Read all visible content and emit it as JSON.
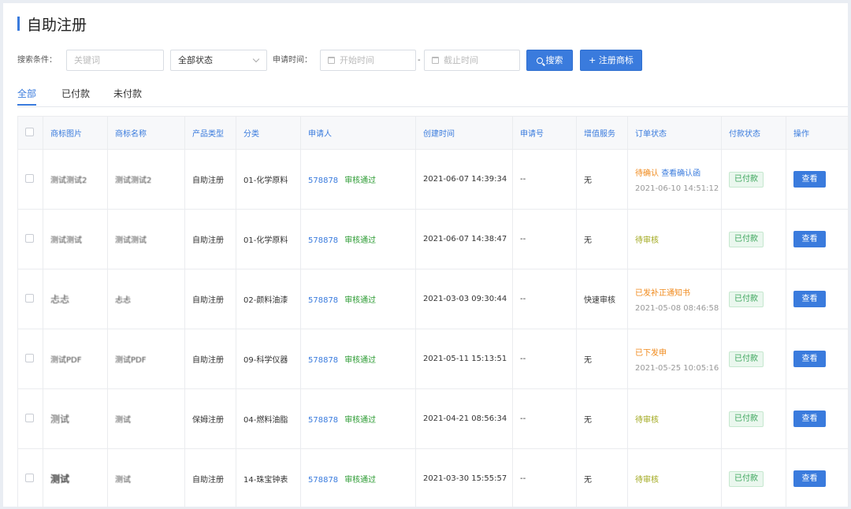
{
  "page": {
    "title": "自助注册"
  },
  "filter": {
    "search_label": "搜索条件：",
    "keyword_placeholder": "关键词",
    "status_value": "全部状态",
    "time_label": "申请时间：",
    "start_placeholder": "开始时间",
    "range_sep": "-",
    "end_placeholder": "截止时间",
    "search_button": "搜索",
    "register_button": "+ 注册商标"
  },
  "tabs": [
    "全部",
    "已付款",
    "未付款"
  ],
  "table": {
    "headers": [
      "商标图片",
      "商标名称",
      "产品类型",
      "分类",
      "申请人",
      "创建时间",
      "申请号",
      "增值服务",
      "订单状态",
      "付款状态",
      "操作"
    ],
    "rows": [
      {
        "image_text": "测试测试2",
        "name": "测试测试2",
        "product": "自助注册",
        "category": "01-化学原料",
        "applicant": "578878",
        "review": "审核通过",
        "created": "2021-06-07 14:39:34",
        "app_no": "--",
        "service": "无",
        "status": "待确认",
        "status_link": "查看确认函",
        "status_time": "2021-06-10 14:51:12",
        "pay": "已付款",
        "action": "查看"
      },
      {
        "image_text": "测试测试",
        "name": "测试测试",
        "product": "自助注册",
        "category": "01-化学原料",
        "applicant": "578878",
        "review": "审核通过",
        "created": "2021-06-07 14:38:47",
        "app_no": "--",
        "service": "无",
        "status": "待审核",
        "status_link": "",
        "status_time": "",
        "pay": "已付款",
        "action": "查看"
      },
      {
        "image_text": "忐忐",
        "name": "忐忐",
        "product": "自助注册",
        "category": "02-颜料油漆",
        "applicant": "578878",
        "review": "审核通过",
        "created": "2021-03-03 09:30:44",
        "app_no": "--",
        "service": "快速审核",
        "status": "已发补正通知书",
        "status_link": "",
        "status_time": "2021-05-08 08:46:58",
        "pay": "已付款",
        "action": "查看"
      },
      {
        "image_text": "测试PDF",
        "name": "测试PDF",
        "product": "自助注册",
        "category": "09-科学仪器",
        "applicant": "578878",
        "review": "审核通过",
        "created": "2021-05-11 15:13:51",
        "app_no": "--",
        "service": "无",
        "status": "已下发申",
        "status_link": "",
        "status_time": "2021-05-25 10:05:16",
        "pay": "已付款",
        "action": "查看"
      },
      {
        "image_text": "测试",
        "name": "测试",
        "product": "保姆注册",
        "category": "04-燃料油脂",
        "applicant": "578878",
        "review": "审核通过",
        "created": "2021-04-21 08:56:34",
        "app_no": "--",
        "service": "无",
        "status": "待审核",
        "status_link": "",
        "status_time": "",
        "pay": "已付款",
        "action": "查看"
      },
      {
        "image_text": "测试",
        "name": "测试",
        "product": "自助注册",
        "category": "14-珠宝钟表",
        "applicant": "578878",
        "review": "审核通过",
        "created": "2021-03-30 15:55:57",
        "app_no": "--",
        "service": "无",
        "status": "待审核",
        "status_link": "",
        "status_time": "",
        "pay": "已付款",
        "action": "查看"
      }
    ]
  },
  "colors": {
    "accent": "#3a7bdd",
    "success": "#2c9b33",
    "warning": "#f08a1c",
    "pending": "#a0a81c"
  },
  "icons": {
    "search": "search-icon",
    "calendar": "calendar-icon",
    "dropdown": "chevron-down-icon"
  }
}
